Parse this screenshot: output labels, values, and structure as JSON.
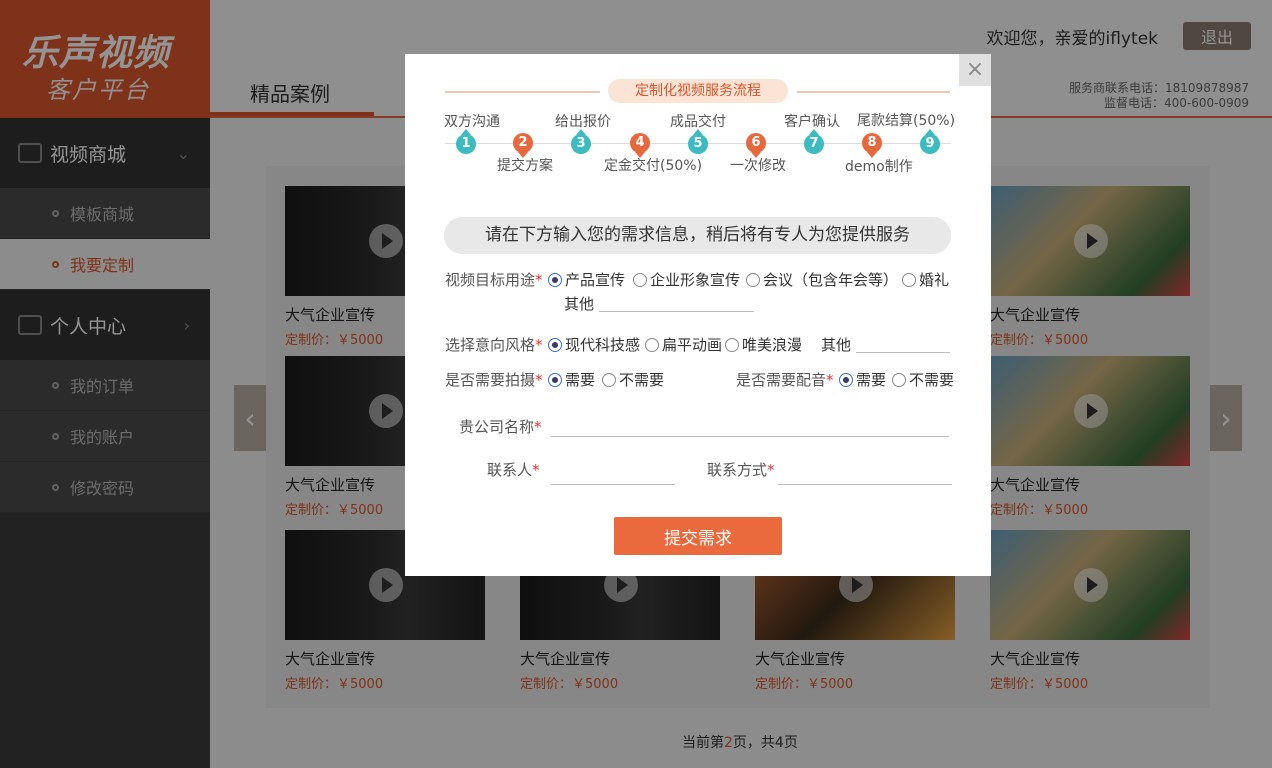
{
  "brand": {
    "line1": "乐声视频",
    "line2": "客户平台"
  },
  "sidebar": {
    "section1": {
      "label": "视频商城"
    },
    "section1_items": [
      {
        "label": "模板商城"
      },
      {
        "label": "我要定制"
      }
    ],
    "section2": {
      "label": "个人中心"
    },
    "section2_items": [
      {
        "label": "我的订单"
      },
      {
        "label": "我的账户"
      },
      {
        "label": "修改密码"
      }
    ]
  },
  "header": {
    "tab": "精品案例",
    "welcome": "欢迎您，亲爱的iflytek",
    "logout": "退出",
    "service_phone": "服务商联系电话：18109878987",
    "supervise_phone": "监督电话：400-600-0909"
  },
  "cases": [
    {
      "title": "大气企业宣传",
      "price": "定制价：￥5000"
    },
    {
      "title": "大气企业宣传",
      "price": "定制价：￥5000"
    },
    {
      "title": "大气企业宣传",
      "price": "定制价：￥5000"
    },
    {
      "title": "大气企业宣传",
      "price": "定制价：￥5000"
    },
    {
      "title": "大气企业宣传",
      "price": "定制价：￥5000"
    },
    {
      "title": "大气企业宣传",
      "price": "定制价：￥5000"
    },
    {
      "title": "大气企业宣传",
      "price": "定制价：￥5000"
    },
    {
      "title": "大气企业宣传",
      "price": "定制价：￥5000"
    },
    {
      "title": "大气企业宣传",
      "price": "定制价：￥5000"
    },
    {
      "title": "大气企业宣传",
      "price": "定制价：￥5000"
    }
  ],
  "pager": {
    "prefix": "当前第",
    "current": "2",
    "suffix": "页，共4页"
  },
  "modal": {
    "close": "×",
    "flow_title": "定制化视频服务流程",
    "steps": [
      {
        "num": "1",
        "label": "双方沟通"
      },
      {
        "num": "2",
        "label": "提交方案"
      },
      {
        "num": "3",
        "label": "给出报价"
      },
      {
        "num": "4",
        "label": "定金交付(50%)"
      },
      {
        "num": "5",
        "label": "成品交付"
      },
      {
        "num": "6",
        "label": "一次修改"
      },
      {
        "num": "7",
        "label": "客户确认"
      },
      {
        "num": "8",
        "label": "demo制作"
      },
      {
        "num": "9",
        "label": "尾款结算(50%)"
      }
    ],
    "banner": "请在下方输入您的需求信息，稍后将有专人为您提供服务",
    "purpose": {
      "label": "视频目标用途",
      "options": [
        "产品宣传",
        "企业形象宣传",
        "会议（包含年会等）",
        "婚礼"
      ],
      "selected": "产品宣传",
      "other_label": "其他"
    },
    "style": {
      "label": "选择意向风格",
      "options": [
        "现代科技感",
        "扁平动画",
        "唯美浪漫"
      ],
      "selected": "现代科技感",
      "other_label": "其他"
    },
    "shoot": {
      "label": "是否需要拍摄",
      "options": [
        "需要",
        "不需要"
      ],
      "selected": "需要"
    },
    "voice": {
      "label": "是否需要配音",
      "options": [
        "需要",
        "不需要"
      ],
      "selected": "需要"
    },
    "company": {
      "label": "贵公司名称",
      "value": ""
    },
    "contact": {
      "label": "联系人",
      "value": ""
    },
    "contact_method": {
      "label": "联系方式",
      "value": ""
    },
    "required_mark": "*",
    "submit": "提交需求"
  }
}
